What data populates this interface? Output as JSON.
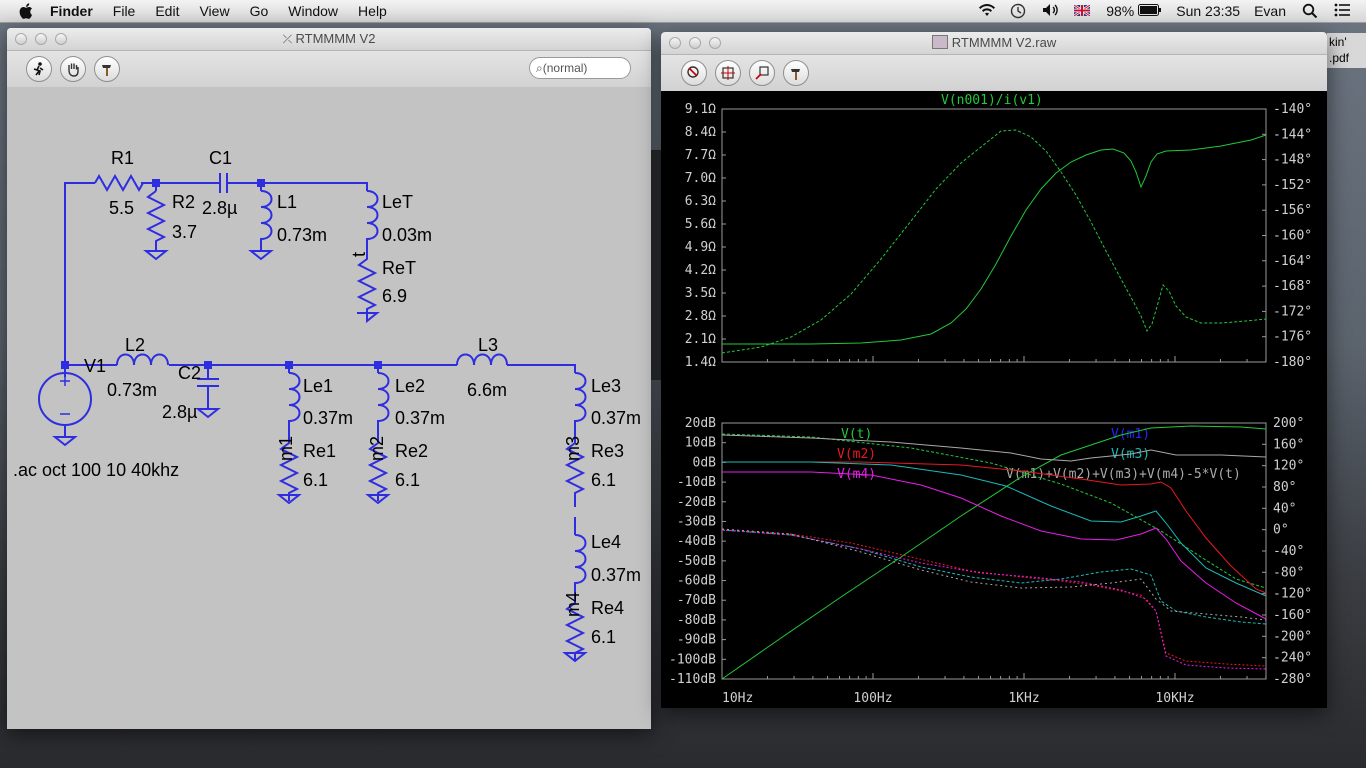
{
  "menubar": {
    "app": "Finder",
    "items": [
      "File",
      "Edit",
      "View",
      "Go",
      "Window",
      "Help"
    ],
    "battery": "98%",
    "clock": "Sun 23:35",
    "user": "Evan"
  },
  "schematic_window": {
    "title": "RTMMMM V2",
    "search_placeholder": "(normal)",
    "components": {
      "R1": {
        "name": "R1",
        "value": "5.5"
      },
      "R2": {
        "name": "R2",
        "value": "3.7"
      },
      "C1": {
        "name": "C1",
        "value": "2.8µ"
      },
      "L1": {
        "name": "L1",
        "value": "0.73m"
      },
      "LeT": {
        "name": "LeT",
        "value": "0.03m"
      },
      "ReT": {
        "name": "ReT",
        "value": "6.9"
      },
      "V1": {
        "name": "V1"
      },
      "L2": {
        "name": "L2",
        "value": "0.73m"
      },
      "C2": {
        "name": "C2",
        "value": "2.8µ"
      },
      "Le1": {
        "name": "Le1",
        "value": "0.37m"
      },
      "Le2": {
        "name": "Le2",
        "value": "0.37m"
      },
      "L3": {
        "name": "L3",
        "value": "6.6m"
      },
      "Le3": {
        "name": "Le3",
        "value": "0.37m"
      },
      "Re1": {
        "name": "Re1",
        "value": "6.1"
      },
      "Re2": {
        "name": "Re2",
        "value": "6.1"
      },
      "Re3": {
        "name": "Re3",
        "value": "6.1"
      },
      "Le4": {
        "name": "Le4",
        "value": "0.37m"
      },
      "Re4": {
        "name": "Re4",
        "value": "6.1"
      }
    },
    "net_labels": {
      "t": "t",
      "m1": "m1",
      "m2": "m2",
      "m3": "m3",
      "m4": "m4"
    },
    "directive": ".ac oct 100 10 40khz"
  },
  "waveform_window": {
    "title": "RTMMMM V2.raw",
    "top_plot": {
      "trace_label": "V(n001)/i(v1)",
      "left_ticks": [
        "9.1Ω",
        "8.4Ω",
        "7.7Ω",
        "7.0Ω",
        "6.3Ω",
        "5.6Ω",
        "4.9Ω",
        "4.2Ω",
        "3.5Ω",
        "2.8Ω",
        "2.1Ω",
        "1.4Ω"
      ],
      "right_ticks": [
        "-140°",
        "-144°",
        "-148°",
        "-152°",
        "-156°",
        "-160°",
        "-164°",
        "-168°",
        "-172°",
        "-176°",
        "-180°"
      ]
    },
    "bottom_plot": {
      "legend": {
        "vt": "V(t)",
        "vm1": "V(m1)",
        "vm2": "V(m2)",
        "vm3": "V(m3)",
        "vm4": "V(m4)",
        "sum": "V(m1)+V(m2)+V(m3)+V(m4)-5*V(t)"
      },
      "left_ticks": [
        "20dB",
        "10dB",
        "0dB",
        "-10dB",
        "-20dB",
        "-30dB",
        "-40dB",
        "-50dB",
        "-60dB",
        "-70dB",
        "-80dB",
        "-90dB",
        "-100dB",
        "-110dB"
      ],
      "right_ticks": [
        "200°",
        "160°",
        "120°",
        "80°",
        "40°",
        "0°",
        "-40°",
        "-80°",
        "-120°",
        "-160°",
        "-200°",
        "-240°",
        "-280°"
      ]
    },
    "x_ticks": [
      "10Hz",
      "100Hz",
      "1KHz",
      "10KHz"
    ],
    "colors": {
      "green": "#22c83a",
      "red": "#e8191e",
      "blue": "#2626ff",
      "cyan": "#1cb8b8",
      "magenta": "#e81ee8",
      "gray": "#a9a9a9"
    }
  },
  "desktop_peek": {
    "line1": "kin'",
    "line2": ".pdf"
  }
}
